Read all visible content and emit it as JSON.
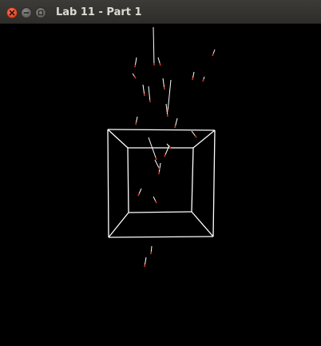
{
  "window": {
    "title": "Lab 11 - Part 1",
    "controls": {
      "close": "close-icon",
      "minimize": "minimize-icon",
      "maximize": "maximize-icon"
    }
  },
  "scene": {
    "background_color": "#000000",
    "box_color": "#ffffff",
    "particle_head_color": "#d2301e",
    "particle_tail_color": "#ffffff"
  }
}
